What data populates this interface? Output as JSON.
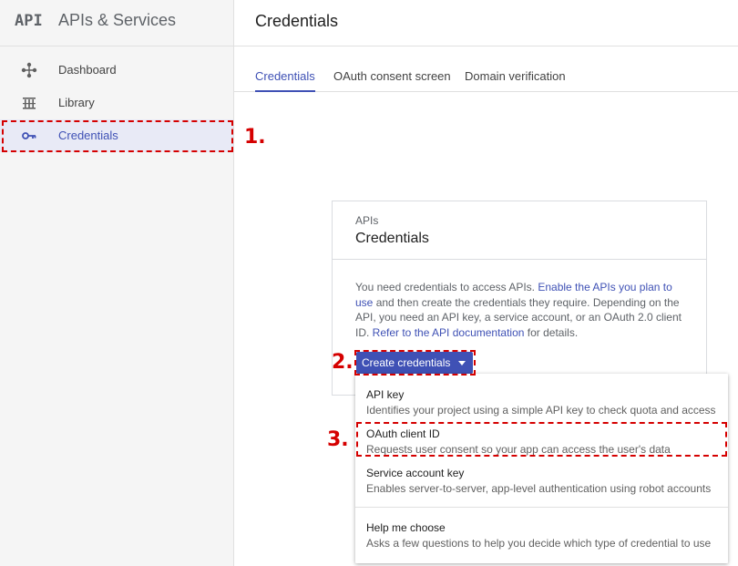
{
  "brand": {
    "logo": "API",
    "title": "APIs & Services"
  },
  "sidebar": {
    "items": [
      {
        "label": "Dashboard",
        "icon": "dashboard-icon"
      },
      {
        "label": "Library",
        "icon": "library-icon"
      },
      {
        "label": "Credentials",
        "icon": "key-icon",
        "active": true
      }
    ]
  },
  "header": {
    "title": "Credentials"
  },
  "tabs": [
    {
      "label": "Credentials",
      "active": true
    },
    {
      "label": "OAuth consent screen"
    },
    {
      "label": "Domain verification"
    }
  ],
  "card": {
    "eyebrow": "APIs",
    "title": "Credentials",
    "body_1": "You need credentials to access APIs. ",
    "link_1": "Enable the APIs you plan to use",
    "body_2": " and then create the credentials they require. Depending on the API, you need an API key, a service account, or an OAuth 2.0 client ID. ",
    "link_2": "Refer to the API documentation",
    "body_3": " for details."
  },
  "create_button": {
    "label": "Create credentials"
  },
  "menu": {
    "items": [
      {
        "title": "API key",
        "desc": "Identifies your project using a simple API key to check quota and access"
      },
      {
        "title": "OAuth client ID",
        "desc": "Requests user consent so your app can access the user's data"
      },
      {
        "title": "Service account key",
        "desc": "Enables server-to-server, app-level authentication using robot accounts"
      },
      {
        "title": "Help me choose",
        "desc": "Asks a few questions to help you decide which type of credential to use"
      }
    ]
  },
  "annotations": {
    "step1": "1.",
    "step2": "2.",
    "step3": "3."
  },
  "colors": {
    "accent": "#3f51b5",
    "annotation": "#d50000",
    "sidebar_bg": "#f5f5f5"
  }
}
